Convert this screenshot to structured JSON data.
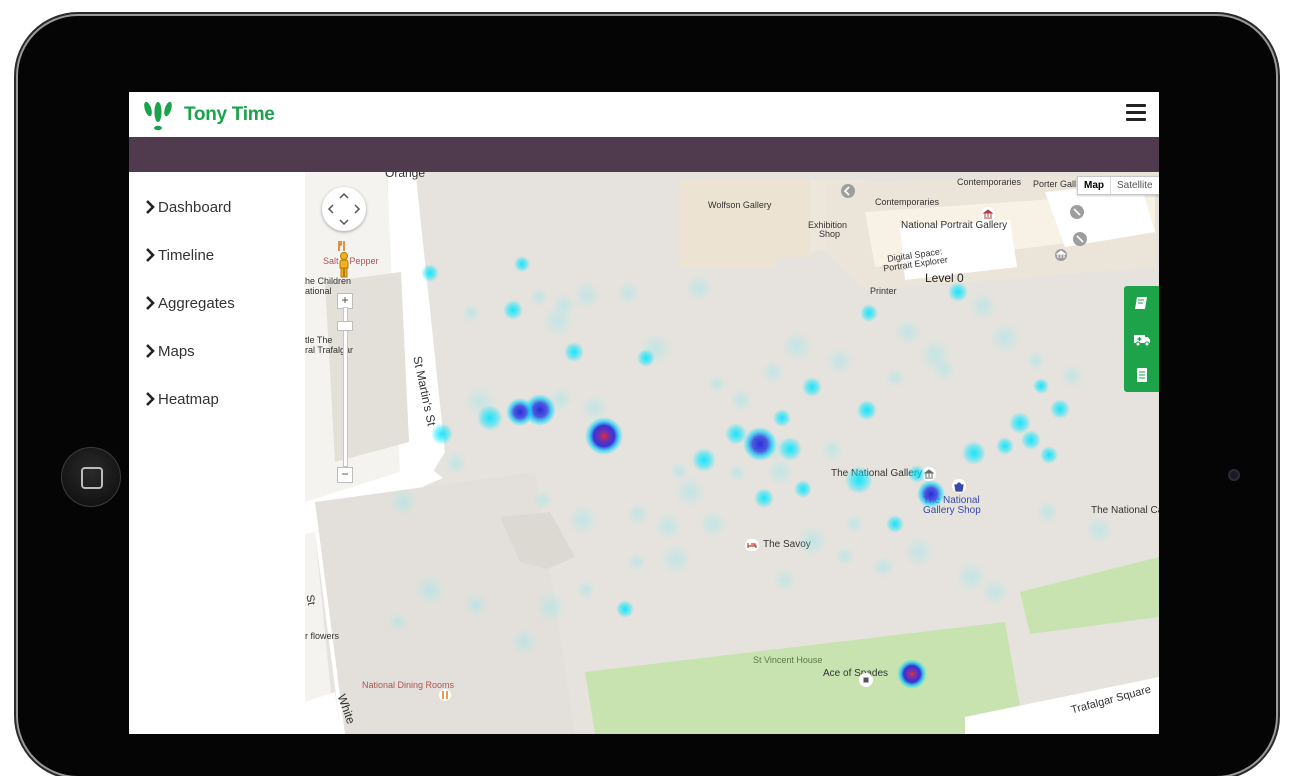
{
  "app": {
    "name": "Tony Time",
    "brand_color": "#1aa34a",
    "header_bar_color": "#4f3a4e"
  },
  "sidebar": {
    "items": [
      {
        "label": "Dashboard"
      },
      {
        "label": "Timeline"
      },
      {
        "label": "Aggregates"
      },
      {
        "label": "Maps"
      },
      {
        "label": "Heatmap"
      }
    ]
  },
  "map": {
    "type_controls": {
      "map_label": "Map",
      "satellite_label": "Satellite",
      "selected": "Map"
    },
    "labels": {
      "orange": "Orange",
      "wolfson": "Wolfson Gallery",
      "contemporaries_1": "Contemporaries",
      "contemporaries_2": "Contemporaries",
      "porter_gallery": "Porter Gall",
      "exhibition_shop_1": "Exhibition",
      "exhibition_shop_2": "Shop",
      "npg": "National Portrait Gallery",
      "digital_space_1": "Digital Space:",
      "digital_space_2": "Portrait Explorer",
      "level": "Level 0",
      "printer": "Printer",
      "salt_pepper": "Salt & Pepper",
      "children_1": "he Children",
      "children_2": "ational",
      "little_the_1": "tle The",
      "little_the_2": "ral Trafalgar",
      "st_martins": "St Martin's St",
      "national_gallery": "The National Gallery",
      "ng_shop_1": "The National",
      "ng_shop_2": "Gallery Shop",
      "national_ca": "The National Ca",
      "savoy": "The Savoy",
      "st_vincent": "St Vincent House",
      "ace_of_spades": "Ace of Spades",
      "trafalgar_square": "Trafalgar Square",
      "flowers": "r flowers",
      "national_dining": "National Dining Rooms",
      "st_left": "St",
      "white": "White"
    },
    "icons": [
      "pan-control-icon",
      "pegman-icon",
      "zoom-in-icon",
      "zoom-out-icon",
      "restaurant-icon",
      "museum-icon",
      "shop-icon",
      "hotel-icon",
      "bar-icon"
    ]
  },
  "floating_panel": {
    "color": "#1ea34a",
    "icons": [
      "book-icon",
      "ambulance-icon",
      "list-icon"
    ]
  },
  "heatmap": {
    "colors": {
      "low": "#00e5ff",
      "mid": "#2b2bd9",
      "high": "#e0302a"
    }
  }
}
